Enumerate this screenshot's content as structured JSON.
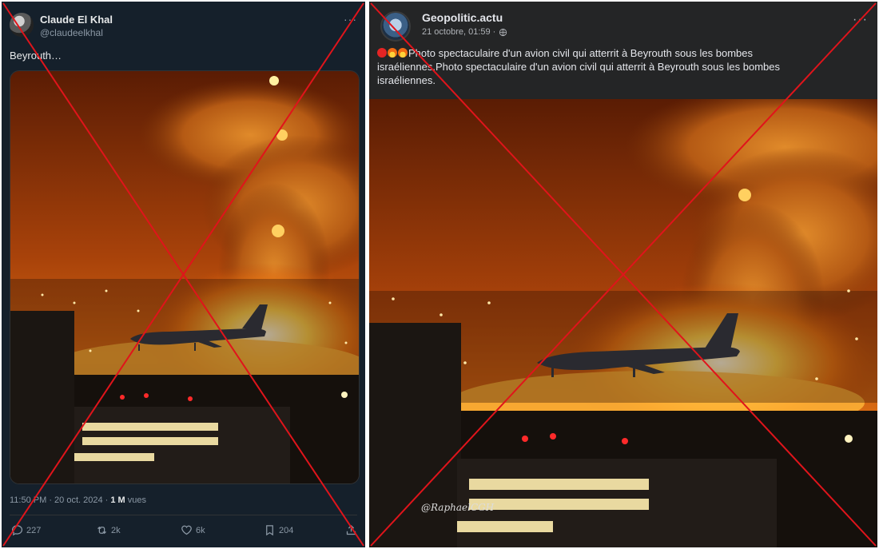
{
  "left_post": {
    "display_name": "Claude El Khal",
    "handle": "@claudeelkhal",
    "more_icon": "ellipsis-icon",
    "text": "Beyrouth…",
    "timestamp": "11:50 PM · 20 oct. 2024 · ",
    "views_count": "1 M",
    "views_label": " vues",
    "actions": {
      "replies": "227",
      "reposts": "2k",
      "likes": "6k",
      "bookmarks": "204"
    }
  },
  "right_post": {
    "page_name": "Geopolitic.actu",
    "date": "21 octobre, 01:59 · ",
    "privacy_icon": "globe-icon",
    "more_icon": "ellipsis-icon",
    "text": "Photo spectaculaire d'un avion civil qui atterrit à Beyrouth sous les bombes israéliennes.Photo spectaculaire d'un avion civil qui atterrit à Beyrouth sous les bombes israéliennes.",
    "emojis": [
      "red-circle-icon",
      "fire-icon",
      "fire-icon"
    ],
    "watermark": "@RaphaelCGH"
  },
  "colors": {
    "cross": "#e0141b",
    "twitter_bg": "#15202b",
    "facebook_bg": "#242526"
  }
}
